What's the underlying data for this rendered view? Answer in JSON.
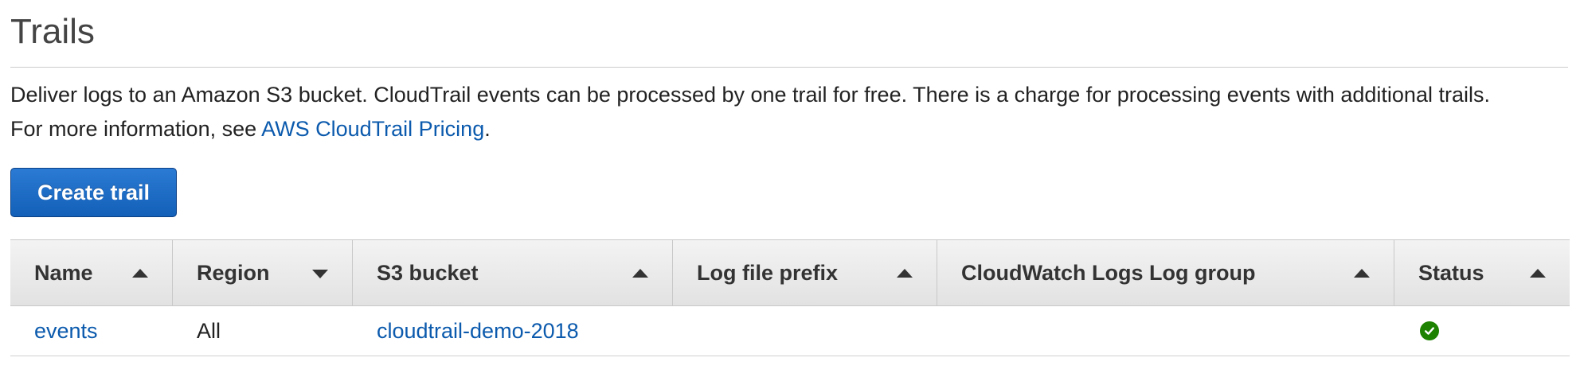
{
  "header": {
    "title": "Trails"
  },
  "description": {
    "line1": "Deliver logs to an Amazon S3 bucket. CloudTrail events can be processed by one trail for free. There is a charge for processing events with additional trails.",
    "line2_prefix": "For more information, see ",
    "pricing_link": "AWS CloudTrail Pricing",
    "line2_suffix": "."
  },
  "actions": {
    "create_trail_label": "Create trail"
  },
  "table": {
    "columns": [
      {
        "label": "Name",
        "sort": "ascending"
      },
      {
        "label": "Region",
        "sort": "descending"
      },
      {
        "label": "S3 bucket",
        "sort": "ascending"
      },
      {
        "label": "Log file prefix",
        "sort": "ascending"
      },
      {
        "label": "CloudWatch Logs Log group",
        "sort": "ascending"
      },
      {
        "label": "Status",
        "sort": "ascending"
      }
    ],
    "rows": [
      {
        "name": "events",
        "region": "All",
        "s3_bucket": "cloudtrail-demo-2018",
        "log_file_prefix": "",
        "cloudwatch_log_group": "",
        "status": "check-circle-icon"
      }
    ]
  },
  "colors": {
    "link": "#0b5aad",
    "primary_button": "#1a6bc5",
    "status_ok": "#1d8102"
  }
}
